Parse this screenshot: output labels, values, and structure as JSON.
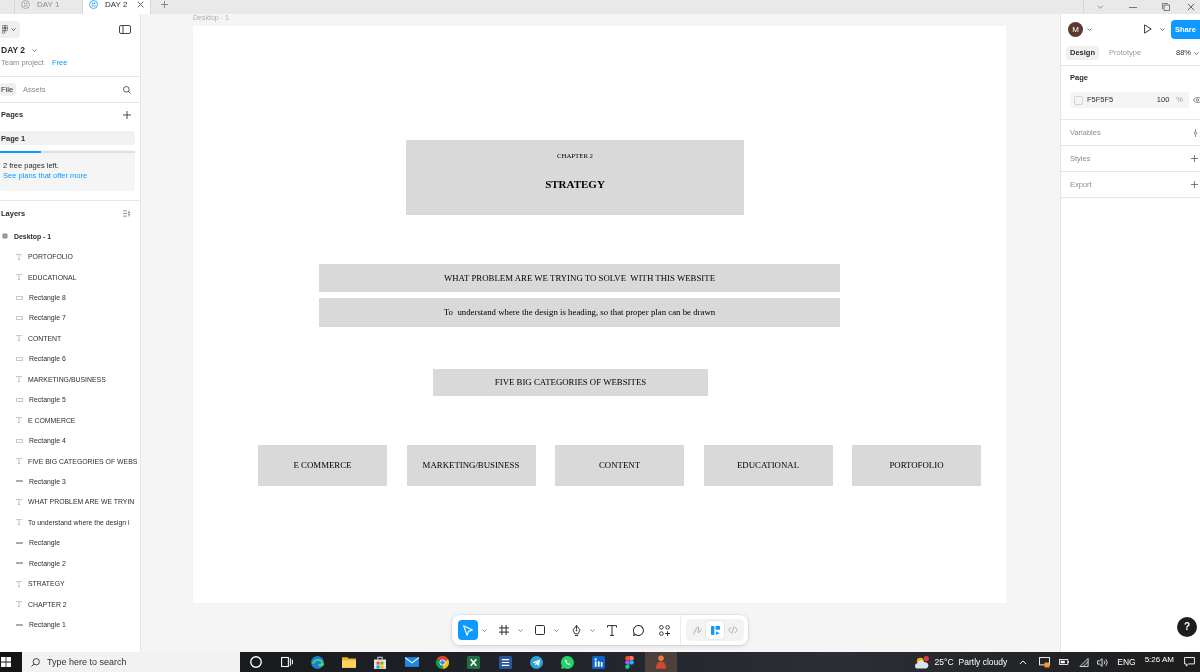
{
  "browser_tabs": [
    {
      "label": "DAY 1",
      "selected": false
    },
    {
      "label": "DAY 2",
      "selected": true
    }
  ],
  "file": {
    "name": "DAY 2",
    "team": "Team project",
    "plan": "Free"
  },
  "left_tabs": [
    {
      "label": "File",
      "selected": true
    },
    {
      "label": "Assets",
      "selected": false
    }
  ],
  "pages": {
    "title": "Pages",
    "items": [
      {
        "label": "Page 1",
        "selected": true
      }
    ]
  },
  "upsell": {
    "level": 0.3,
    "text": "2 free pages left.",
    "link": "See plans that offer more"
  },
  "layers": {
    "title": "Layers",
    "items": [
      {
        "name": "Desktop - 1",
        "kind": "frame",
        "children": [
          {
            "name": "PORTOFOLIO",
            "kind": "text"
          },
          {
            "name": "EDUCATIONAL",
            "kind": "text"
          },
          {
            "name": "Rectangle 8",
            "kind": "rect"
          },
          {
            "name": "Rectangle 7",
            "kind": "rect"
          },
          {
            "name": "CONTENT",
            "kind": "text"
          },
          {
            "name": "Rectangle 6",
            "kind": "rect"
          },
          {
            "name": "MARKETING/BUSINESS",
            "kind": "text"
          },
          {
            "name": "Rectangle 5",
            "kind": "rect"
          },
          {
            "name": "E COMMERCE",
            "kind": "text"
          },
          {
            "name": "Rectangle 4",
            "kind": "rect"
          },
          {
            "name": "FIVE BIG CATEGORIES OF WEBS",
            "kind": "text"
          },
          {
            "name": "Rectangle 3",
            "kind": "line"
          },
          {
            "name": "WHAT PROBLEM ARE WE TRYIN",
            "kind": "text"
          },
          {
            "name": "To understand where the design i",
            "kind": "text"
          },
          {
            "name": "Rectangle",
            "kind": "line"
          },
          {
            "name": "Rectangle 2",
            "kind": "line"
          },
          {
            "name": "STRATEGY",
            "kind": "text"
          },
          {
            "name": "CHAPTER 2",
            "kind": "text"
          },
          {
            "name": "Rectangle 1",
            "kind": "line"
          }
        ]
      }
    ]
  },
  "canvas": {
    "frame_label": "Desktop - 1",
    "chapter": {
      "label": "CHAPTER 2",
      "title": "STRATEGY"
    },
    "question": "WHAT PROBLEM ARE WE TRYING TO SOLVE  WITH THIS WEBSITE",
    "answer": "To  understand where the design is heading, so that proper plan can be drawn",
    "categories_title": "FIVE BIG CATEGORIES OF WEBSITES",
    "categories": [
      "E COMMERCE",
      "MARKETING/BUSINESS",
      "CONTENT",
      "EDUCATIONAL",
      "PORTOFOLIO"
    ]
  },
  "toolbar": {
    "tools": [
      {
        "kind": "move",
        "selected": true,
        "menu": true
      },
      {
        "kind": "frame",
        "selected": false,
        "menu": true
      },
      {
        "kind": "shape",
        "selected": false,
        "menu": true
      },
      {
        "kind": "pen",
        "selected": false,
        "menu": true
      },
      {
        "kind": "text",
        "selected": false,
        "menu": false
      },
      {
        "kind": "comment",
        "selected": false,
        "menu": false
      },
      {
        "kind": "actions",
        "selected": false,
        "menu": false
      }
    ],
    "modes": [
      {
        "kind": "draw",
        "selected": false
      },
      {
        "kind": "design",
        "selected": true
      },
      {
        "kind": "dev",
        "selected": false
      }
    ]
  },
  "right_panel": {
    "avatar": "M",
    "share": "Share",
    "tabs": [
      {
        "label": "Design",
        "selected": true
      },
      {
        "label": "Prototype",
        "selected": false
      }
    ],
    "zoom": "88%",
    "page": {
      "title": "Page",
      "fill": "F5F5F5",
      "opacity": "100",
      "unit": "%"
    },
    "sections": [
      {
        "label": "Variables",
        "kind": "variables"
      },
      {
        "label": "Styles",
        "kind": "add"
      },
      {
        "label": "Export",
        "kind": "add"
      }
    ]
  },
  "help": "?",
  "taskbar": {
    "search_placeholder": "Type here to search",
    "apps": [
      {
        "kind": "cortana",
        "active": false
      },
      {
        "kind": "taskview",
        "active": false
      },
      {
        "kind": "edge",
        "active": false
      },
      {
        "kind": "explorer",
        "active": false
      },
      {
        "kind": "store",
        "active": false
      },
      {
        "kind": "mail",
        "active": false
      },
      {
        "kind": "chrome",
        "active": false
      },
      {
        "kind": "excel",
        "active": false
      },
      {
        "kind": "word",
        "active": false
      },
      {
        "kind": "telegram",
        "active": false
      },
      {
        "kind": "whatsapp",
        "active": false
      },
      {
        "kind": "linkedin",
        "active": false
      },
      {
        "kind": "figma",
        "active": false
      },
      {
        "kind": "app",
        "active": true
      }
    ],
    "weather": {
      "temperature": "25°C",
      "condition": "Partly cloudy"
    },
    "language": "ENG",
    "time": "5:26 AM"
  }
}
